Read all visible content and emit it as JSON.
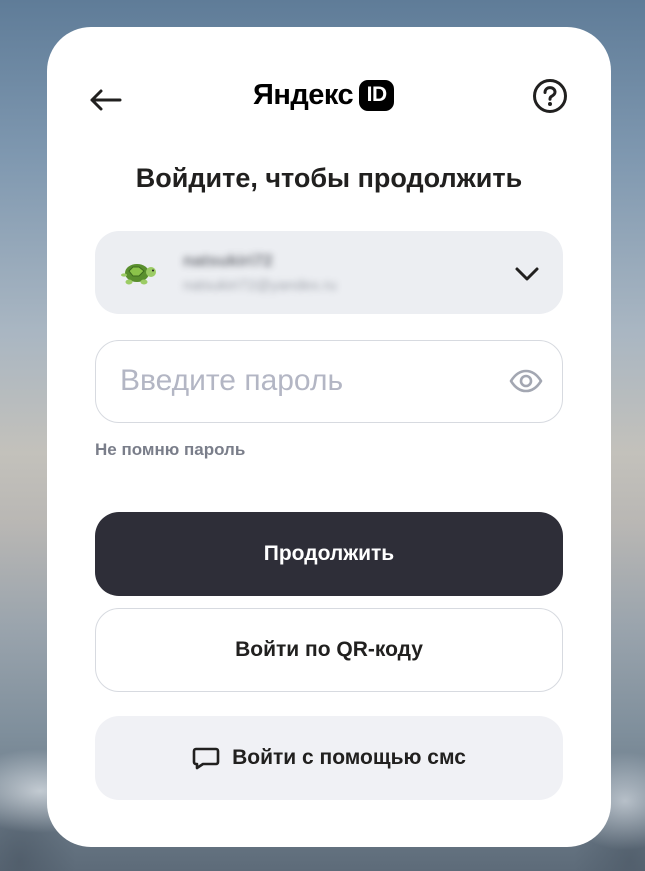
{
  "header": {
    "logo_text": "Яндекс",
    "logo_badge": "ID"
  },
  "title": "Войдите, чтобы продолжить",
  "account": {
    "name": "natsukiri72",
    "email": "natsukiri72@yandex.ru",
    "avatar_icon": "turtle-icon"
  },
  "password": {
    "placeholder": "Введите пароль",
    "value": ""
  },
  "forgot_label": "Не помню пароль",
  "buttons": {
    "continue": "Продолжить",
    "qr": "Войти по QR-коду",
    "sms": "Войти с помощью смс"
  },
  "colors": {
    "primary_button": "#2e2e38",
    "account_bg": "#eceef2",
    "placeholder": "#b3b6c4"
  }
}
